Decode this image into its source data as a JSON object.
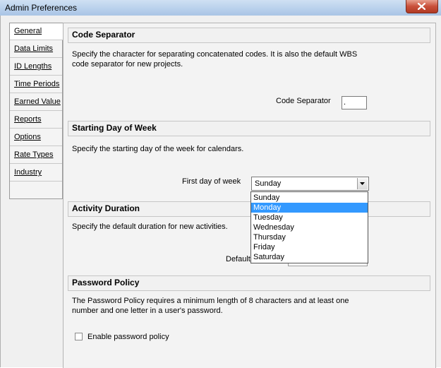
{
  "window": {
    "title": "Admin Preferences",
    "close_icon": "close-icon"
  },
  "tabs": [
    {
      "label": "General",
      "active": true
    },
    {
      "label": "Data Limits",
      "active": false
    },
    {
      "label": "ID Lengths",
      "active": false
    },
    {
      "label": "Time Periods",
      "active": false
    },
    {
      "label": "Earned Value",
      "active": false
    },
    {
      "label": "Reports",
      "active": false
    },
    {
      "label": "Options",
      "active": false
    },
    {
      "label": "Rate Types",
      "active": false
    },
    {
      "label": "Industry",
      "active": false
    }
  ],
  "code_separator": {
    "title": "Code Separator",
    "desc_line1": "Specify the character for separating concatenated codes.  It is also the default WBS",
    "desc_line2": "code separator for new projects.",
    "field_label": "Code Separator",
    "value": "."
  },
  "starting_day": {
    "title": "Starting Day of Week",
    "desc": "Specify the starting day of the week for calendars.",
    "field_label": "First day of week",
    "selected": "Sunday",
    "options": [
      "Sunday",
      "Monday",
      "Tuesday",
      "Wednesday",
      "Thursday",
      "Friday",
      "Saturday"
    ],
    "highlighted": "Monday"
  },
  "activity_duration": {
    "title": "Activity Duration",
    "desc": "Specify the default duration for new activities.",
    "field_label": "Default"
  },
  "password_policy": {
    "title": "Password Policy",
    "desc_line1": "The Password Policy requires a minimum length of 8 characters and at least one",
    "desc_line2": "number and one letter in a user's password.",
    "checkbox_label": "Enable password policy",
    "checked": false
  },
  "colors": {
    "selection": "#3399ff",
    "close_button": "#c9503a"
  }
}
